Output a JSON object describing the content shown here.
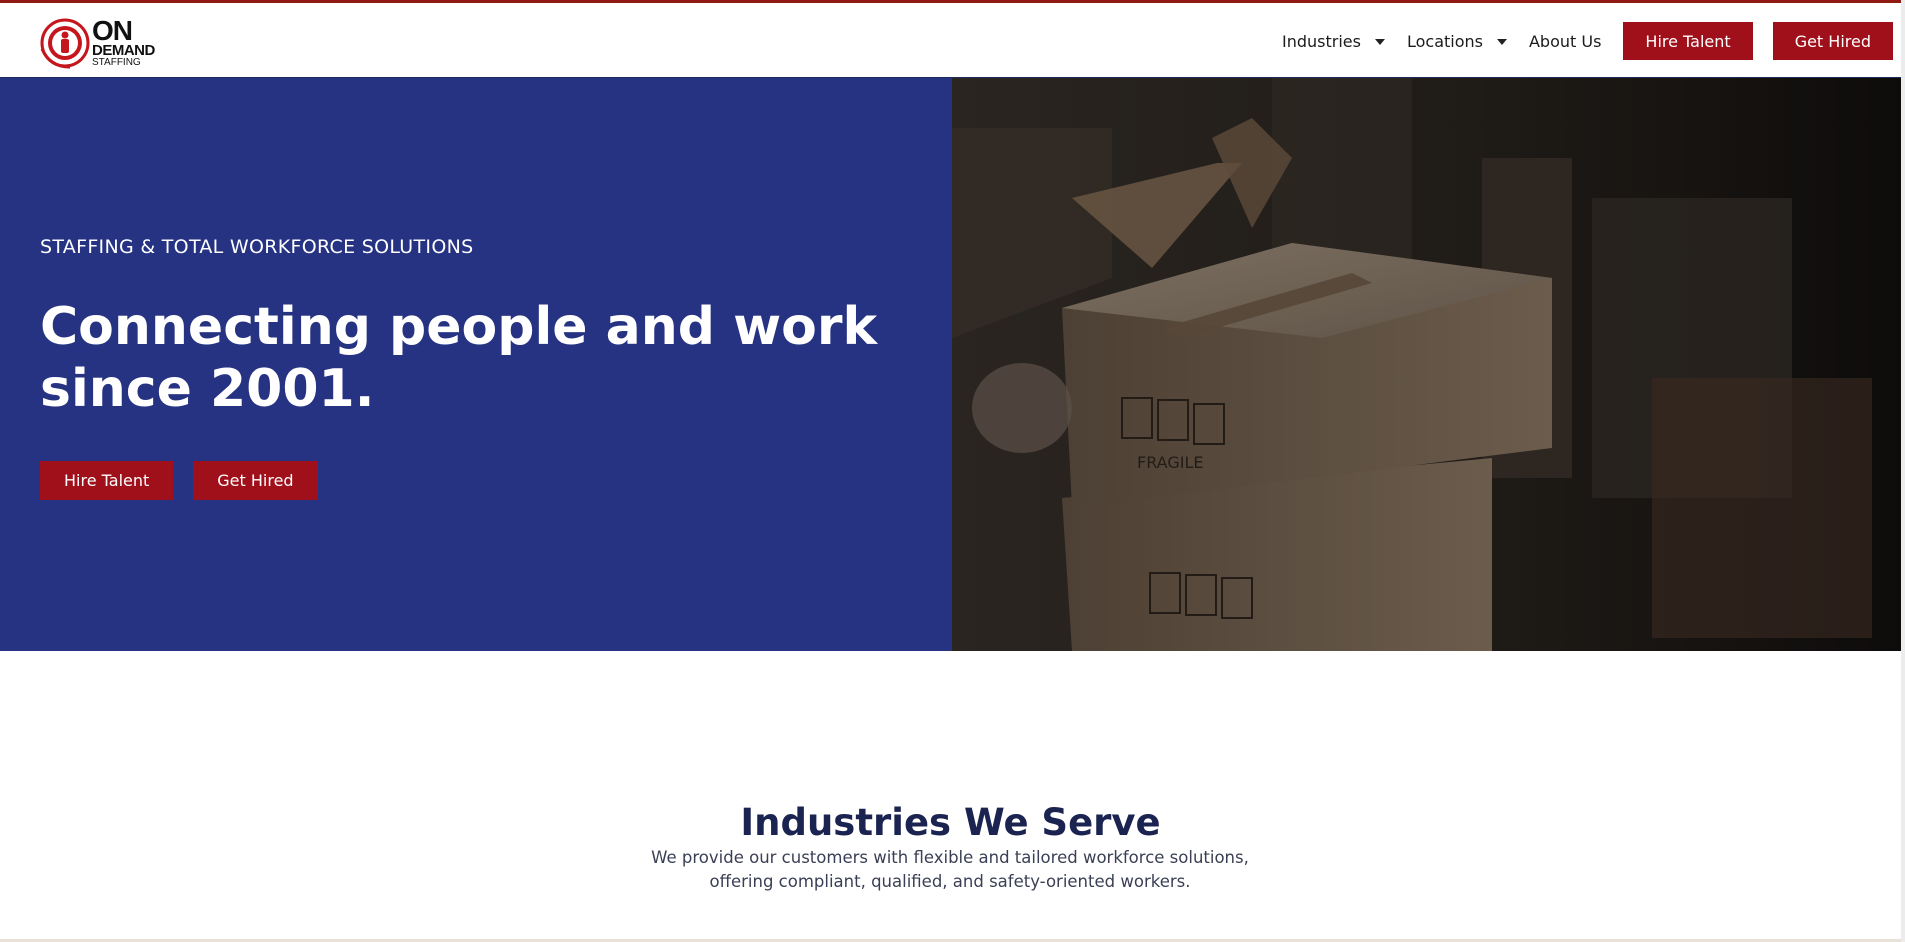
{
  "brand": {
    "logo_on": "ON",
    "logo_demand": "DEMAND",
    "logo_staffing": "STAFFING"
  },
  "nav": {
    "items": [
      {
        "label": "Industries"
      },
      {
        "label": "Locations"
      },
      {
        "label": "About Us"
      }
    ],
    "hire_talent": "Hire Talent",
    "get_hired": "Get Hired"
  },
  "hero": {
    "eyebrow": "STAFFING & TOTAL WORKFORCE SOLUTIONS",
    "title": "Connecting people and work since 2001.",
    "hire_talent": "Hire Talent",
    "get_hired": "Get Hired",
    "box_label": "FRAGILE"
  },
  "industries": {
    "title": "Industries We Serve",
    "subtitle_line1": "We provide our customers with flexible and tailored workforce solutions,",
    "subtitle_line2": "offering compliant, qualified, and safety-oriented workers."
  },
  "colors": {
    "brand_red": "#a0101b",
    "hero_blue": "#263282",
    "heading_navy": "#1b2350"
  },
  "icons": [
    "caret-down-icon",
    "caret-down-icon"
  ]
}
